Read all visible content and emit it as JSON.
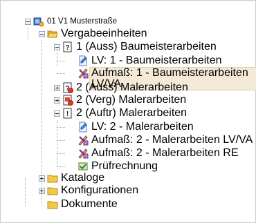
{
  "tree": {
    "root": {
      "label": "01 V1 Musterstraße",
      "icon": "project-icon",
      "expanded": true
    },
    "vergabe": {
      "label": "Vergabeeinheiten",
      "icon": "folder-open-icon",
      "expanded": true
    },
    "items": [
      {
        "label": "1 (Auss) Baumeisterarbeiten",
        "icon": "question-doc-icon",
        "expanded": true
      },
      {
        "label": "LV: 1 - Baumeisterarbeiten",
        "icon": "lv-doc-icon"
      },
      {
        "label": "Aufmaß: 1 - Baumeisterarbeiten LV/VA",
        "icon": "measure-tools-icon",
        "selected": true
      },
      {
        "label": "2 (Auss) Malerarbeiten",
        "icon": "question-doc-red-icon",
        "expanded": false
      },
      {
        "label": "2 (Verg) Malerarbeiten",
        "icon": "award-doc-icon",
        "expanded": false
      },
      {
        "label": "2 (Auftr) Malerarbeiten",
        "icon": "exclamation-doc-icon",
        "expanded": true
      },
      {
        "label": "LV: 2 - Malerarbeiten",
        "icon": "lv-doc-icon"
      },
      {
        "label": "Aufmaß: 2 - Malerarbeiten LV/VA",
        "icon": "measure-tools-icon"
      },
      {
        "label": "Aufmaß: 2 - Malerarbeiten RE",
        "icon": "measure-tools-icon"
      },
      {
        "label": "Prüfrechnung",
        "icon": "invoice-check-icon"
      }
    ],
    "kataloge": {
      "label": "Kataloge",
      "icon": "folder-icon",
      "expanded": false
    },
    "konfigurationen": {
      "label": "Konfigurationen",
      "icon": "folder-icon",
      "expanded": false
    },
    "dokumente": {
      "label": "Dokumente",
      "icon": "folder-icon"
    }
  },
  "colors": {
    "selection": "#f3e9d6",
    "treeLines": "#a0a7b0",
    "folder": "#f2c94c"
  }
}
